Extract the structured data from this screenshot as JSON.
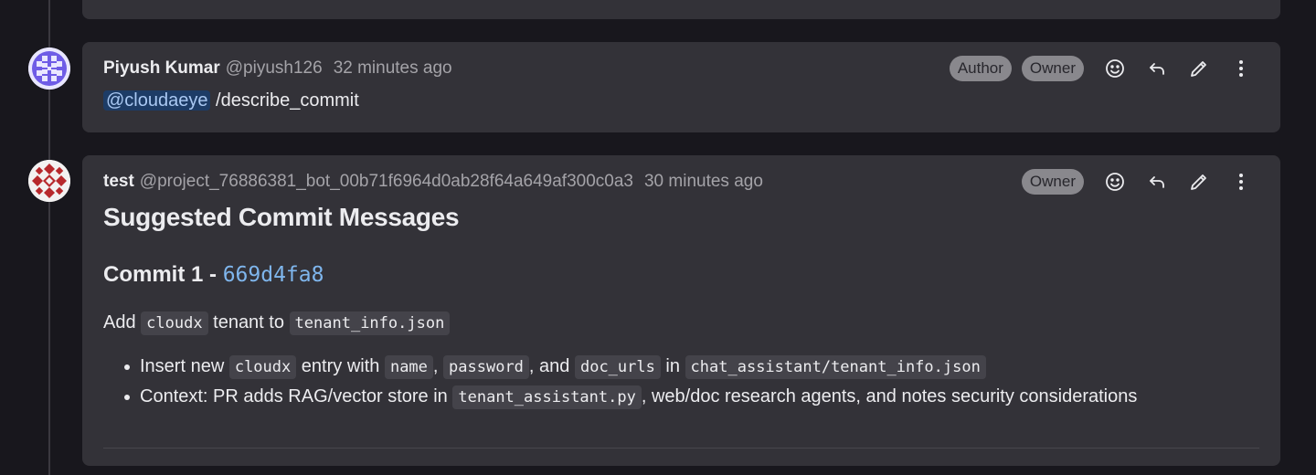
{
  "comments": [
    {
      "author_name": "Piyush Kumar",
      "author_handle": "@piyush126",
      "timestamp": "32 minutes ago",
      "badges": [
        "Author",
        "Owner"
      ],
      "mention": "@cloudaeye",
      "command": " /describe_commit"
    },
    {
      "author_name": "test",
      "author_handle": "@project_76886381_bot_00b71f6964d0ab28f64a649af300c0a3",
      "timestamp": "30 minutes ago",
      "badges": [
        "Owner"
      ],
      "title": "Suggested Commit Messages",
      "commit_heading": "Commit 1 - ",
      "commit_sha": "669d4fa8",
      "summary": {
        "p1": "Add ",
        "code1": "cloudx",
        "p2": " tenant to ",
        "code2": "tenant_info.json"
      },
      "bullets": [
        {
          "t1": "Insert new ",
          "c1": "cloudx",
          "t2": " entry with ",
          "c2": "name",
          "t3": ", ",
          "c3": "password",
          "t4": ", and ",
          "c4": "doc_urls",
          "t5": " in ",
          "c5": "chat_assistant/tenant_info.json"
        },
        {
          "t1": "Context: PR adds RAG/vector store in ",
          "c1": "tenant_assistant.py",
          "t2": ", web/doc research agents, and notes security considerations"
        }
      ]
    }
  ],
  "icons": [
    "emoji-icon",
    "reply-icon",
    "edit-icon",
    "more-options-icon"
  ]
}
